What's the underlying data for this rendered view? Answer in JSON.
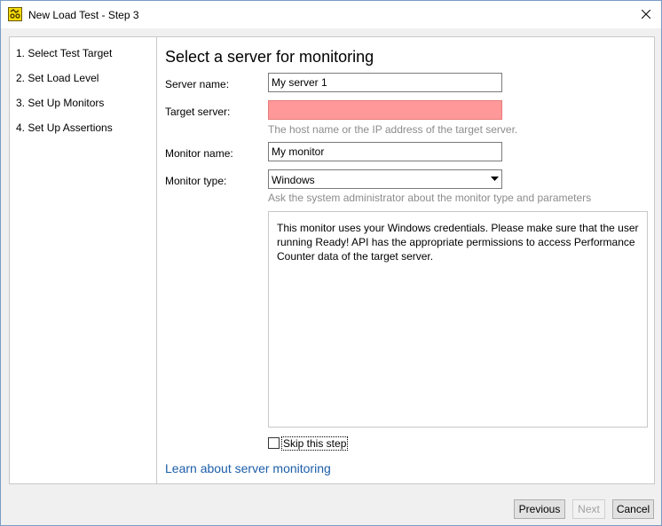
{
  "window": {
    "title": "New Load Test - Step 3"
  },
  "steps": [
    {
      "label": "1. Select Test Target"
    },
    {
      "label": "2. Set Load Level"
    },
    {
      "label": "3. Set Up Monitors"
    },
    {
      "label": "4. Set Up Assertions"
    }
  ],
  "form": {
    "heading": "Select a server for monitoring",
    "server_name_label": "Server name:",
    "server_name_value": "My server 1",
    "target_server_label": "Target server:",
    "target_server_value": "",
    "target_server_hint": "The host name or the IP address of the target server.",
    "monitor_name_label": "Monitor name:",
    "monitor_name_value": "My monitor",
    "monitor_type_label": "Monitor type:",
    "monitor_type_value": "Windows",
    "monitor_type_hint": "Ask the system administrator about the monitor type and parameters",
    "info_text": "This monitor uses your Windows credentials. Please make sure that the user running Ready! API has the appropriate permissions to access Performance Counter data of the target server.",
    "skip_label": "Skip this step",
    "learn_link": "Learn about server monitoring"
  },
  "buttons": {
    "previous": "Previous",
    "next": "Next",
    "cancel": "Cancel"
  },
  "colors": {
    "error_field": "#ff9999",
    "link": "#1c5ea8",
    "hint": "#8c8c8c"
  }
}
